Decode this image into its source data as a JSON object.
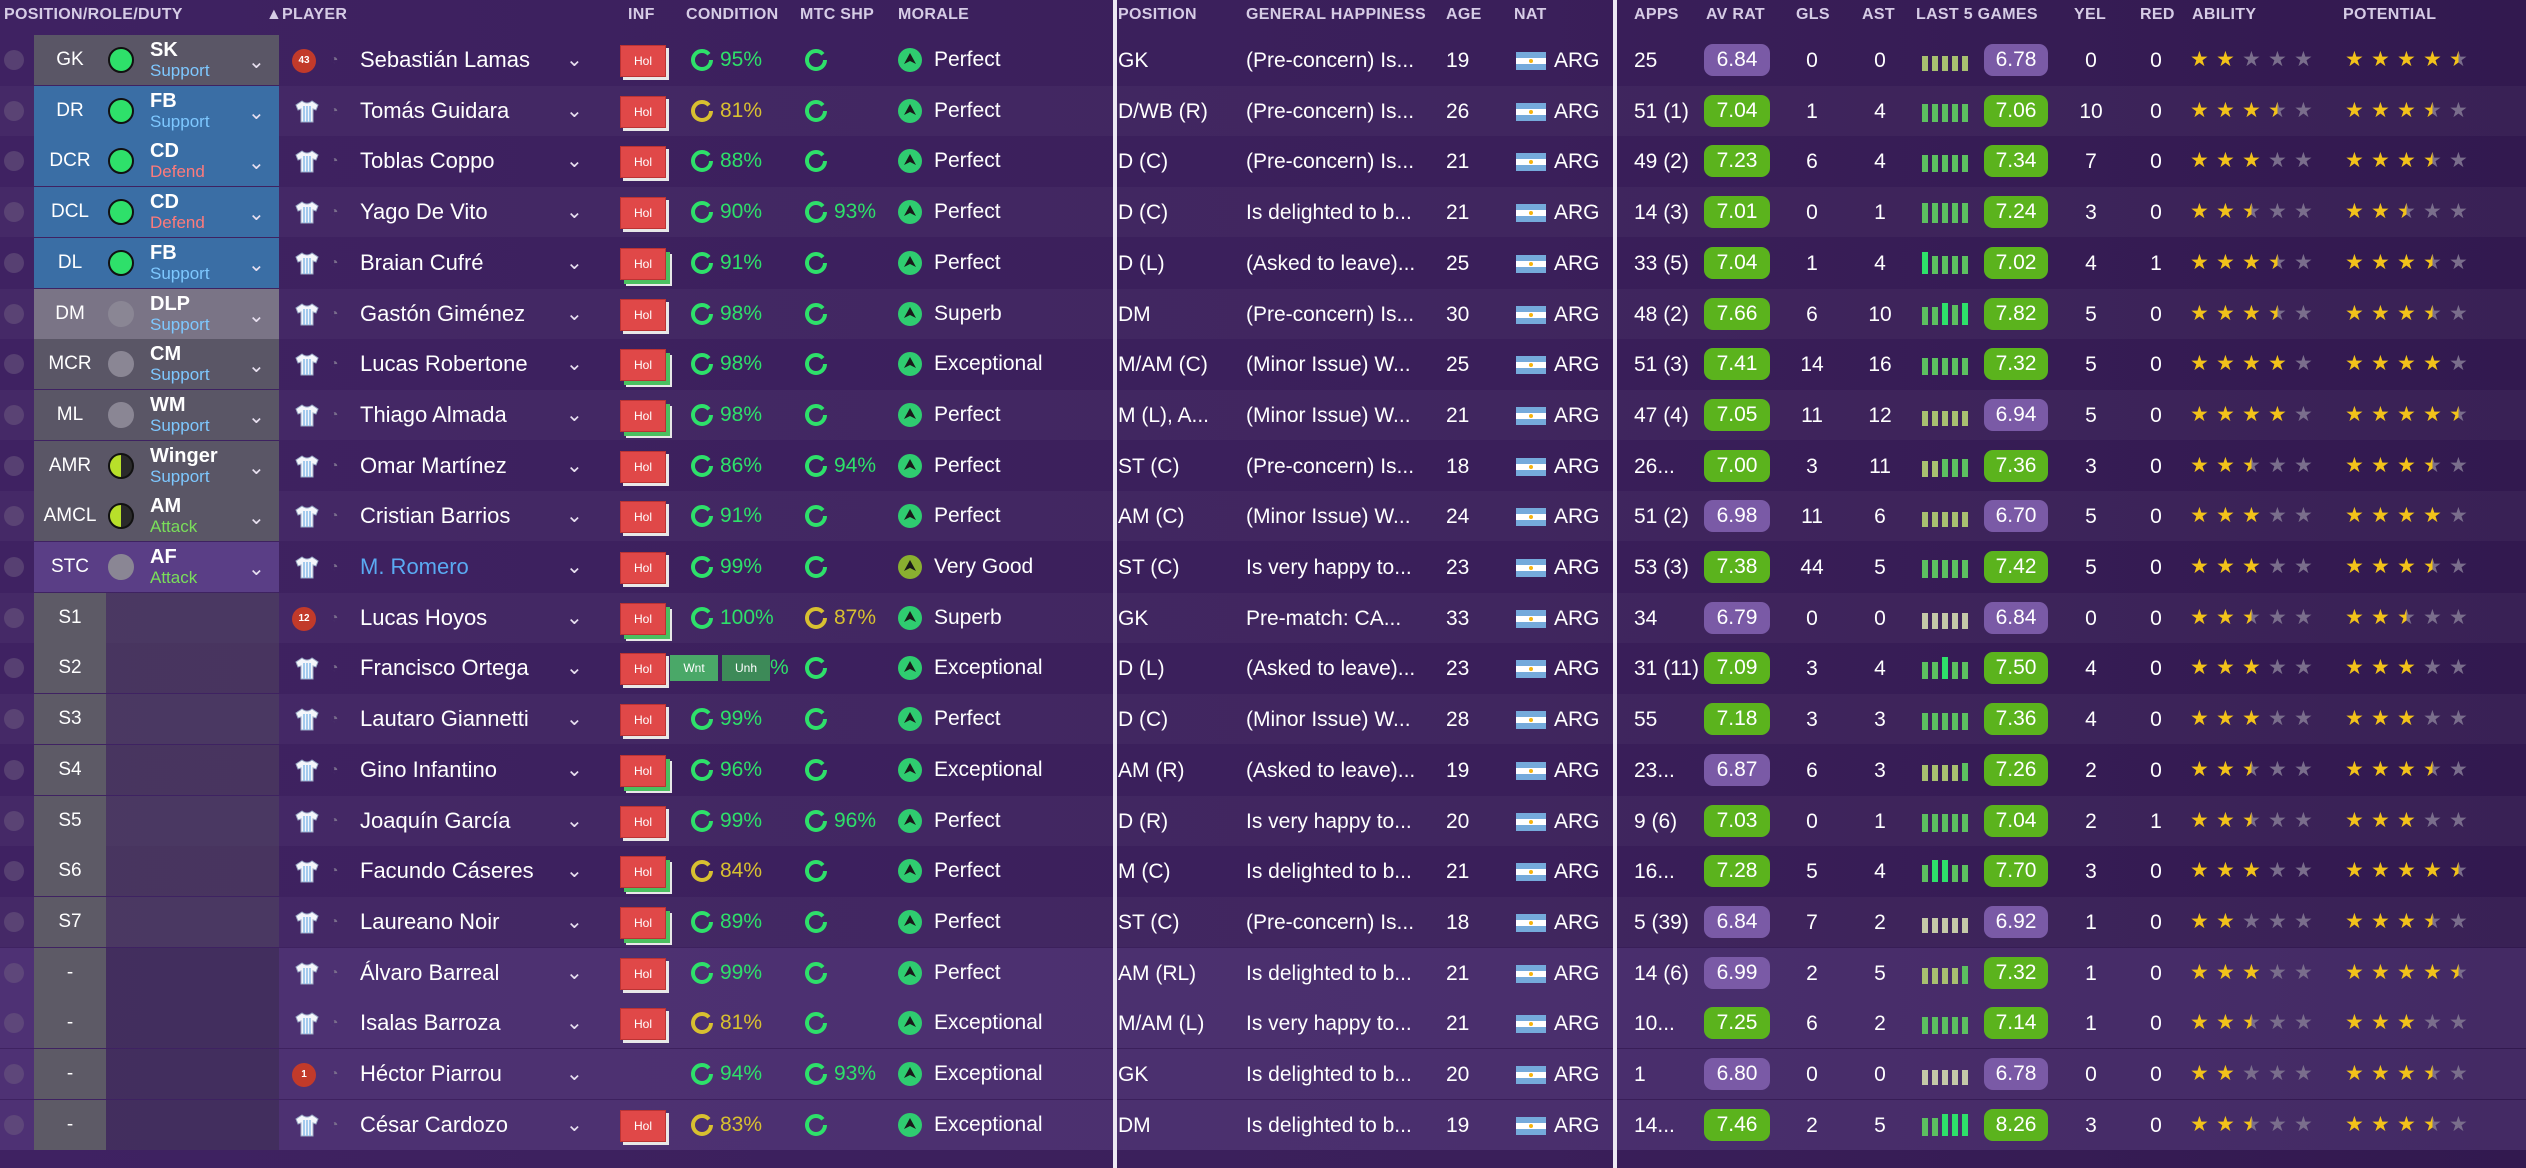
{
  "headers": {
    "position_role_duty": "POSITION/ROLE/DUTY",
    "player": "PLAYER",
    "inf": "INF",
    "condition": "CONDITION",
    "mtc_shp": "MTC SHP",
    "morale": "MORALE",
    "position": "POSITION",
    "general_happiness": "GENERAL HAPPINESS",
    "age": "AGE",
    "nat": "NAT",
    "apps": "APPS",
    "av_rat": "AV RAT",
    "gls": "GLS",
    "ast": "AST",
    "last5": "LAST 5 GAMES",
    "yel": "YEL",
    "red": "RED",
    "ability": "ABILITY",
    "potential": "POTENTIAL"
  },
  "sort_indicator": "▲",
  "colors": {
    "green_rating": "#5bb31d",
    "purple_rating": "#7a5aa6",
    "role_blue": "#3a6ea5",
    "role_gray": "#5a5666",
    "role_selected_gray": "#7a7486",
    "hol_red": "#e04848",
    "condition_green": "#2ee06a",
    "condition_yellow": "#d8c030",
    "morale_green": "#2fcc70",
    "morale_olive": "#8ab030",
    "star_gold": "#f2c21a"
  },
  "rows": [
    {
      "pos": "GK",
      "role": "SK",
      "duty": "Support",
      "role_icon": "full",
      "role_bg": "gray",
      "badge": "43",
      "name": "Sebastián Lamas",
      "hol": true,
      "stack": false,
      "cond": "95%",
      "cond_color": "green",
      "mtc": "",
      "morale": "Perfect",
      "position": "GK",
      "happiness": "(Pre-concern) Is...",
      "age": "19",
      "nat": "ARG",
      "apps": "25",
      "avrat": "6.84",
      "avcol": "purple",
      "gls": "0",
      "ast": "0",
      "bars": [
        0.7,
        0.7,
        0.7,
        0.7,
        0.7
      ],
      "l5": "6.78",
      "l5col": "purple",
      "yel": "0",
      "red": "0",
      "ability": 2,
      "potential": 4.5
    },
    {
      "pos": "DR",
      "role": "FB",
      "duty": "Support",
      "role_icon": "full",
      "role_bg": "blue",
      "name": "Tomás Guidara",
      "hol": true,
      "stack": false,
      "cond": "81%",
      "cond_color": "yellow",
      "mtc": "",
      "morale": "Perfect",
      "position": "D/WB (R)",
      "happiness": "(Pre-concern) Is...",
      "age": "26",
      "nat": "ARG",
      "apps": "51 (1)",
      "avrat": "7.04",
      "avcol": "green",
      "gls": "1",
      "ast": "4",
      "bars": [
        0.8,
        0.8,
        0.8,
        0.8,
        0.8
      ],
      "l5": "7.06",
      "l5col": "green",
      "yel": "10",
      "red": "0",
      "ability": 3.5,
      "potential": 3.5
    },
    {
      "pos": "DCR",
      "role": "CD",
      "duty": "Defend",
      "role_icon": "full",
      "role_bg": "blue",
      "name": "Toblas Coppo",
      "hol": true,
      "stack": false,
      "cond": "88%",
      "cond_color": "green",
      "mtc": "",
      "morale": "Perfect",
      "position": "D (C)",
      "happiness": "(Pre-concern) Is...",
      "age": "21",
      "nat": "ARG",
      "apps": "49 (2)",
      "avrat": "7.23",
      "avcol": "green",
      "gls": "6",
      "ast": "4",
      "bars": [
        0.8,
        0.8,
        0.8,
        0.8,
        0.8
      ],
      "l5": "7.34",
      "l5col": "green",
      "yel": "7",
      "red": "0",
      "ability": 3,
      "potential": 3.5
    },
    {
      "pos": "DCL",
      "role": "CD",
      "duty": "Defend",
      "role_icon": "full",
      "role_bg": "blue",
      "name": "Yago De Vito",
      "hol": true,
      "stack": false,
      "cond": "90%",
      "cond_color": "green",
      "mtc": "93%",
      "morale": "Perfect",
      "position": "D (C)",
      "happiness": "Is delighted to b...",
      "age": "21",
      "nat": "ARG",
      "apps": "14 (3)",
      "avrat": "7.01",
      "avcol": "green",
      "gls": "0",
      "ast": "1",
      "bars": [
        0.9,
        0.9,
        0.9,
        0.9,
        0.9
      ],
      "l5": "7.24",
      "l5col": "green",
      "yel": "3",
      "red": "0",
      "ability": 2.5,
      "potential": 2.5
    },
    {
      "pos": "DL",
      "role": "FB",
      "duty": "Support",
      "role_icon": "full",
      "role_bg": "blue",
      "name": "Braian Cufré",
      "hol": true,
      "stack": true,
      "cond": "91%",
      "cond_color": "green",
      "mtc": "",
      "morale": "Perfect",
      "position": "D (L)",
      "happiness": "(Asked to leave)...",
      "age": "25",
      "nat": "ARG",
      "apps": "33 (5)",
      "avrat": "7.04",
      "avcol": "green",
      "gls": "1",
      "ast": "4",
      "bars": [
        1,
        0.8,
        0.8,
        0.8,
        0.8
      ],
      "l5": "7.02",
      "l5col": "green",
      "yel": "4",
      "red": "1",
      "ability": 3.5,
      "potential": 3.5
    },
    {
      "pos": "DM",
      "role": "DLP",
      "duty": "Support",
      "role_icon": "none",
      "role_bg": "sel",
      "name": "Gastón Giménez",
      "hol": true,
      "stack": false,
      "cond": "98%",
      "cond_color": "green",
      "mtc": "",
      "morale": "Superb",
      "position": "DM",
      "happiness": "(Pre-concern) Is...",
      "age": "30",
      "nat": "ARG",
      "apps": "48 (2)",
      "avrat": "7.66",
      "avcol": "green",
      "gls": "6",
      "ast": "10",
      "bars": [
        0.8,
        0.8,
        1,
        0.9,
        1
      ],
      "l5": "7.82",
      "l5col": "green",
      "yel": "5",
      "red": "0",
      "ability": 3.5,
      "potential": 3.5
    },
    {
      "pos": "MCR",
      "role": "CM",
      "duty": "Support",
      "role_icon": "none",
      "role_bg": "gray",
      "name": "Lucas Robertone",
      "hol": true,
      "stack": true,
      "cond": "98%",
      "cond_color": "green",
      "mtc": "",
      "morale": "Exceptional",
      "position": "M/AM (C)",
      "happiness": "(Minor Issue) W...",
      "age": "25",
      "nat": "ARG",
      "apps": "51 (3)",
      "avrat": "7.41",
      "avcol": "green",
      "gls": "14",
      "ast": "16",
      "bars": [
        0.8,
        0.8,
        0.8,
        0.8,
        0.8
      ],
      "l5": "7.32",
      "l5col": "green",
      "yel": "5",
      "red": "0",
      "ability": 4,
      "potential": 4
    },
    {
      "pos": "ML",
      "role": "WM",
      "duty": "Support",
      "role_icon": "none",
      "role_bg": "gray",
      "name": "Thiago Almada",
      "hol": true,
      "stack": true,
      "cond": "98%",
      "cond_color": "green",
      "mtc": "",
      "morale": "Perfect",
      "position": "M (L), A...",
      "happiness": "(Minor Issue) W...",
      "age": "21",
      "nat": "ARG",
      "apps": "47 (4)",
      "avrat": "7.05",
      "avcol": "green",
      "gls": "11",
      "ast": "12",
      "bars": [
        0.7,
        0.7,
        0.7,
        0.7,
        0.7
      ],
      "l5": "6.94",
      "l5col": "purple",
      "yel": "5",
      "red": "0",
      "ability": 4,
      "potential": 4.5
    },
    {
      "pos": "AMR",
      "role": "Winger",
      "duty": "Support",
      "role_icon": "half",
      "role_bg": "gray",
      "name": "Omar Martínez",
      "hol": true,
      "stack": false,
      "cond": "86%",
      "cond_color": "green",
      "mtc": "94%",
      "morale": "Perfect",
      "position": "ST (C)",
      "happiness": "(Pre-concern) Is...",
      "age": "18",
      "nat": "ARG",
      "apps": "26...",
      "avrat": "7.00",
      "avcol": "green",
      "gls": "3",
      "ast": "11",
      "bars": [
        0.7,
        0.7,
        0.8,
        0.8,
        0.8
      ],
      "l5": "7.36",
      "l5col": "green",
      "yel": "3",
      "red": "0",
      "ability": 2.5,
      "potential": 3.5
    },
    {
      "pos": "AMCL",
      "role": "AM",
      "duty": "Attack",
      "role_icon": "half",
      "role_bg": "gray",
      "name": "Cristian Barrios",
      "hol": true,
      "stack": false,
      "cond": "91%",
      "cond_color": "green",
      "mtc": "",
      "morale": "Perfect",
      "position": "AM (C)",
      "happiness": "(Minor Issue) W...",
      "age": "24",
      "nat": "ARG",
      "apps": "51 (2)",
      "avrat": "6.98",
      "avcol": "purple",
      "gls": "11",
      "ast": "6",
      "bars": [
        0.7,
        0.7,
        0.7,
        0.7,
        0.7
      ],
      "l5": "6.70",
      "l5col": "purple",
      "yel": "5",
      "red": "0",
      "ability": 3,
      "potential": 4
    },
    {
      "pos": "STC",
      "role": "AF",
      "duty": "Attack",
      "role_icon": "none",
      "role_bg": "purple",
      "name": "M. Romero",
      "link": true,
      "hol": true,
      "stack": false,
      "cond": "99%",
      "cond_color": "green",
      "mtc": "",
      "morale": "Very Good",
      "morale_col": "olive",
      "position": "ST (C)",
      "happiness": "Is very happy to...",
      "age": "23",
      "nat": "ARG",
      "apps": "53 (3)",
      "avrat": "7.38",
      "avcol": "green",
      "gls": "44",
      "ast": "5",
      "bars": [
        0.8,
        0.8,
        0.8,
        0.8,
        0.8
      ],
      "l5": "7.42",
      "l5col": "green",
      "yel": "5",
      "red": "0",
      "ability": 3,
      "potential": 3.5
    },
    {
      "pos": "S1",
      "role": "",
      "badge": "12",
      "name": "Lucas Hoyos",
      "hol": true,
      "stack": true,
      "cond": "100%",
      "cond_color": "green",
      "mtc": "87%",
      "mtc_color": "yellow",
      "morale": "Superb",
      "position": "GK",
      "happiness": "Pre-match: CA...",
      "age": "33",
      "nat": "ARG",
      "apps": "34",
      "avrat": "6.79",
      "avcol": "purple",
      "gls": "0",
      "ast": "0",
      "bars": [
        0,
        0,
        0,
        0,
        0
      ],
      "l5": "6.84",
      "l5col": "purple",
      "yel": "0",
      "red": "0",
      "ability": 2.5,
      "potential": 2.5
    },
    {
      "pos": "S2",
      "role": "",
      "name": "Francisco Ortega",
      "hol": true,
      "stack": false,
      "wnt": "Wnt",
      "unh": "Unh",
      "cond": "%",
      "cond_color": "green",
      "mtc": "",
      "morale": "Exceptional",
      "position": "D (L)",
      "happiness": "(Asked to leave)...",
      "age": "23",
      "nat": "ARG",
      "apps": "31 (11)",
      "avrat": "7.09",
      "avcol": "green",
      "gls": "3",
      "ast": "4",
      "bars": [
        0.8,
        0.8,
        1,
        0.8,
        0.8
      ],
      "l5": "7.50",
      "l5col": "green",
      "yel": "4",
      "red": "0",
      "ability": 3,
      "potential": 3
    },
    {
      "pos": "S3",
      "role": "",
      "name": "Lautaro Giannetti",
      "hol": true,
      "stack": false,
      "cond": "99%",
      "cond_color": "green",
      "mtc": "",
      "morale": "Perfect",
      "position": "D (C)",
      "happiness": "(Minor Issue) W...",
      "age": "28",
      "nat": "ARG",
      "apps": "55",
      "avrat": "7.18",
      "avcol": "green",
      "gls": "3",
      "ast": "3",
      "bars": [
        0.8,
        0.8,
        0.8,
        0.8,
        0.8
      ],
      "l5": "7.36",
      "l5col": "green",
      "yel": "4",
      "red": "0",
      "ability": 3,
      "potential": 3
    },
    {
      "pos": "S4",
      "role": "",
      "name": "Gino Infantino",
      "hol": true,
      "stack": true,
      "cond": "96%",
      "cond_color": "green",
      "mtc": "",
      "morale": "Exceptional",
      "position": "AM (R)",
      "happiness": "(Asked to leave)...",
      "age": "19",
      "nat": "ARG",
      "apps": "23...",
      "avrat": "6.87",
      "avcol": "purple",
      "gls": "6",
      "ast": "3",
      "bars": [
        0.7,
        0.7,
        0.7,
        0.7,
        0.8
      ],
      "l5": "7.26",
      "l5col": "green",
      "yel": "2",
      "red": "0",
      "ability": 2.5,
      "potential": 3.5
    },
    {
      "pos": "S5",
      "role": "",
      "name": "Joaquín García",
      "hol": true,
      "stack": false,
      "cond": "99%",
      "cond_color": "green",
      "mtc": "96%",
      "morale": "Perfect",
      "position": "D (R)",
      "happiness": "Is very happy to...",
      "age": "20",
      "nat": "ARG",
      "apps": "9 (6)",
      "avrat": "7.03",
      "avcol": "green",
      "gls": "0",
      "ast": "1",
      "bars": [
        0.8,
        0.8,
        0.8,
        0.8,
        0.8
      ],
      "l5": "7.04",
      "l5col": "green",
      "yel": "2",
      "red": "1",
      "ability": 2.5,
      "potential": 3
    },
    {
      "pos": "S6",
      "role": "",
      "name": "Facundo Cáseres",
      "hol": true,
      "stack": true,
      "cond": "84%",
      "cond_color": "yellow",
      "mtc": "",
      "morale": "Perfect",
      "position": "M (C)",
      "happiness": "Is delighted to b...",
      "age": "21",
      "nat": "ARG",
      "apps": "16...",
      "avrat": "7.28",
      "avcol": "green",
      "gls": "5",
      "ast": "4",
      "bars": [
        0.8,
        1,
        1,
        0.8,
        0.8
      ],
      "l5": "7.70",
      "l5col": "green",
      "yel": "3",
      "red": "0",
      "ability": 3,
      "potential": 4.5
    },
    {
      "pos": "S7",
      "role": "",
      "name": "Laureano Noir",
      "hol": true,
      "stack": true,
      "cond": "89%",
      "cond_color": "green",
      "mtc": "",
      "morale": "Perfect",
      "position": "ST (C)",
      "happiness": "(Pre-concern) Is...",
      "age": "18",
      "nat": "ARG",
      "apps": "5 (39)",
      "avrat": "6.84",
      "avcol": "purple",
      "gls": "7",
      "ast": "2",
      "bars": [
        0,
        0,
        0,
        0,
        0
      ],
      "l5": "6.92",
      "l5col": "purple",
      "yel": "1",
      "red": "0",
      "ability": 2,
      "potential": 3.5
    },
    {
      "pos": "-",
      "role": "",
      "name": "Álvaro Barreal",
      "hol": true,
      "stack": false,
      "cond": "99%",
      "cond_color": "green",
      "mtc": "",
      "morale": "Perfect",
      "position": "AM (RL)",
      "happiness": "Is delighted to b...",
      "age": "21",
      "nat": "ARG",
      "apps": "14 (6)",
      "avrat": "6.99",
      "avcol": "purple",
      "gls": "2",
      "ast": "5",
      "bars": [
        0.7,
        0.7,
        0.7,
        0.7,
        0.8
      ],
      "l5": "7.32",
      "l5col": "green",
      "yel": "1",
      "red": "0",
      "ability": 3,
      "potential": 4.5,
      "res": true
    },
    {
      "pos": "-",
      "role": "",
      "name": "Isalas Barroza",
      "hol": true,
      "stack": false,
      "cond": "81%",
      "cond_color": "yellow",
      "mtc": "",
      "morale": "Exceptional",
      "position": "M/AM (L)",
      "happiness": "Is very happy to...",
      "age": "21",
      "nat": "ARG",
      "apps": "10...",
      "avrat": "7.25",
      "avcol": "green",
      "gls": "6",
      "ast": "2",
      "bars": [
        0.8,
        0.8,
        0.8,
        0.8,
        0.8
      ],
      "l5": "7.14",
      "l5col": "green",
      "yel": "1",
      "red": "0",
      "ability": 2.5,
      "potential": 3,
      "res": true
    },
    {
      "pos": "-",
      "role": "",
      "badge": "1",
      "name": "Héctor Piarrou",
      "hol": false,
      "stack": false,
      "cond": "94%",
      "cond_color": "green",
      "mtc": "93%",
      "morale": "Exceptional",
      "position": "GK",
      "happiness": "Is delighted to b...",
      "age": "20",
      "nat": "ARG",
      "apps": "1",
      "avrat": "6.80",
      "avcol": "purple",
      "gls": "0",
      "ast": "0",
      "bars": [
        0,
        0,
        0,
        0,
        0
      ],
      "l5": "6.78",
      "l5col": "purple",
      "yel": "0",
      "red": "0",
      "ability": 2,
      "potential": 3.5,
      "res": true
    },
    {
      "pos": "-",
      "role": "",
      "name": "César Cardozo",
      "hol": true,
      "stack": false,
      "cond": "83%",
      "cond_color": "yellow",
      "mtc": "",
      "morale": "Exceptional",
      "position": "DM",
      "happiness": "Is delighted to b...",
      "age": "19",
      "nat": "ARG",
      "apps": "14...",
      "avrat": "7.46",
      "avcol": "green",
      "gls": "2",
      "ast": "5",
      "bars": [
        0.8,
        0.8,
        1,
        1,
        1
      ],
      "l5": "8.26",
      "l5col": "green",
      "yel": "3",
      "red": "0",
      "ability": 2.5,
      "potential": 3.5,
      "res": true
    }
  ],
  "hol_label": "Hol",
  "chevron": "⌄",
  "star": "★"
}
